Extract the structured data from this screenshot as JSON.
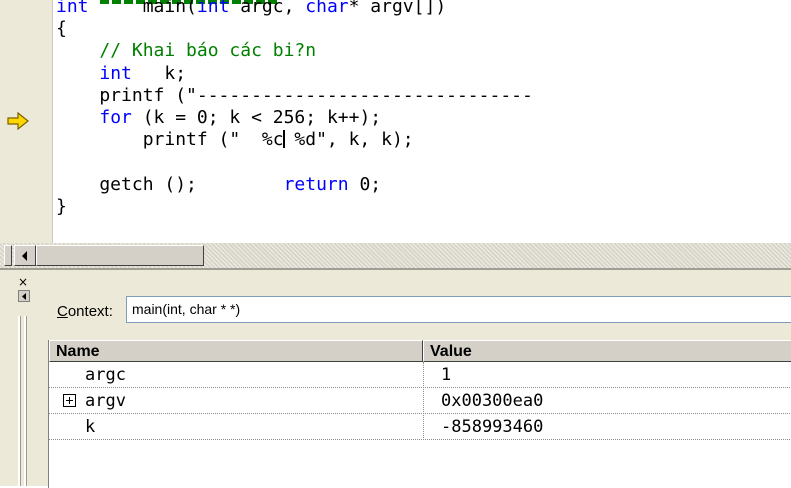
{
  "editor": {
    "lines": [
      [
        {
          "t": "int",
          "c": "kw"
        },
        {
          "t": "     main("
        },
        {
          "t": "int",
          "c": "kw"
        },
        {
          "t": " argc, "
        },
        {
          "t": "char",
          "c": "kw"
        },
        {
          "t": "* argv[])"
        }
      ],
      [
        {
          "t": "{"
        }
      ],
      [
        {
          "t": "    "
        },
        {
          "t": "// Khai báo các bi?n",
          "c": "cm"
        }
      ],
      [
        {
          "t": "    "
        },
        {
          "t": "int",
          "c": "kw"
        },
        {
          "t": "   k;"
        }
      ],
      [
        {
          "t": "    printf (\"-------------------------------"
        }
      ],
      [
        {
          "t": "    "
        },
        {
          "t": "for",
          "c": "kw"
        },
        {
          "t": " (k = 0; k < 256; k++);"
        }
      ],
      [
        {
          "t": "        printf (\"  %c"
        },
        {
          "cursor": true
        },
        {
          "t": " %d\", k, k);"
        }
      ],
      [
        {
          "t": ""
        }
      ],
      [
        {
          "t": "    getch ();        "
        },
        {
          "t": "return",
          "c": "kw"
        },
        {
          "t": " 0;"
        }
      ],
      [
        {
          "t": "}"
        }
      ]
    ],
    "current_line_marker": "arrow-icon",
    "colors": {
      "keyword": "#0000ff",
      "comment": "#008000",
      "arrow": "#ffd700"
    }
  },
  "watch": {
    "close_icon": "×",
    "context_label_accel": "C",
    "context_label_rest": "ontext:",
    "context_value": "main(int, char * *)",
    "headers": {
      "name": "Name",
      "value": "Value"
    },
    "rows": [
      {
        "name": "argc",
        "value": "1",
        "expandable": false
      },
      {
        "name": "argv",
        "value": "0x00300ea0",
        "expandable": true
      },
      {
        "name": "k",
        "value": "-858993460",
        "expandable": false
      }
    ]
  }
}
